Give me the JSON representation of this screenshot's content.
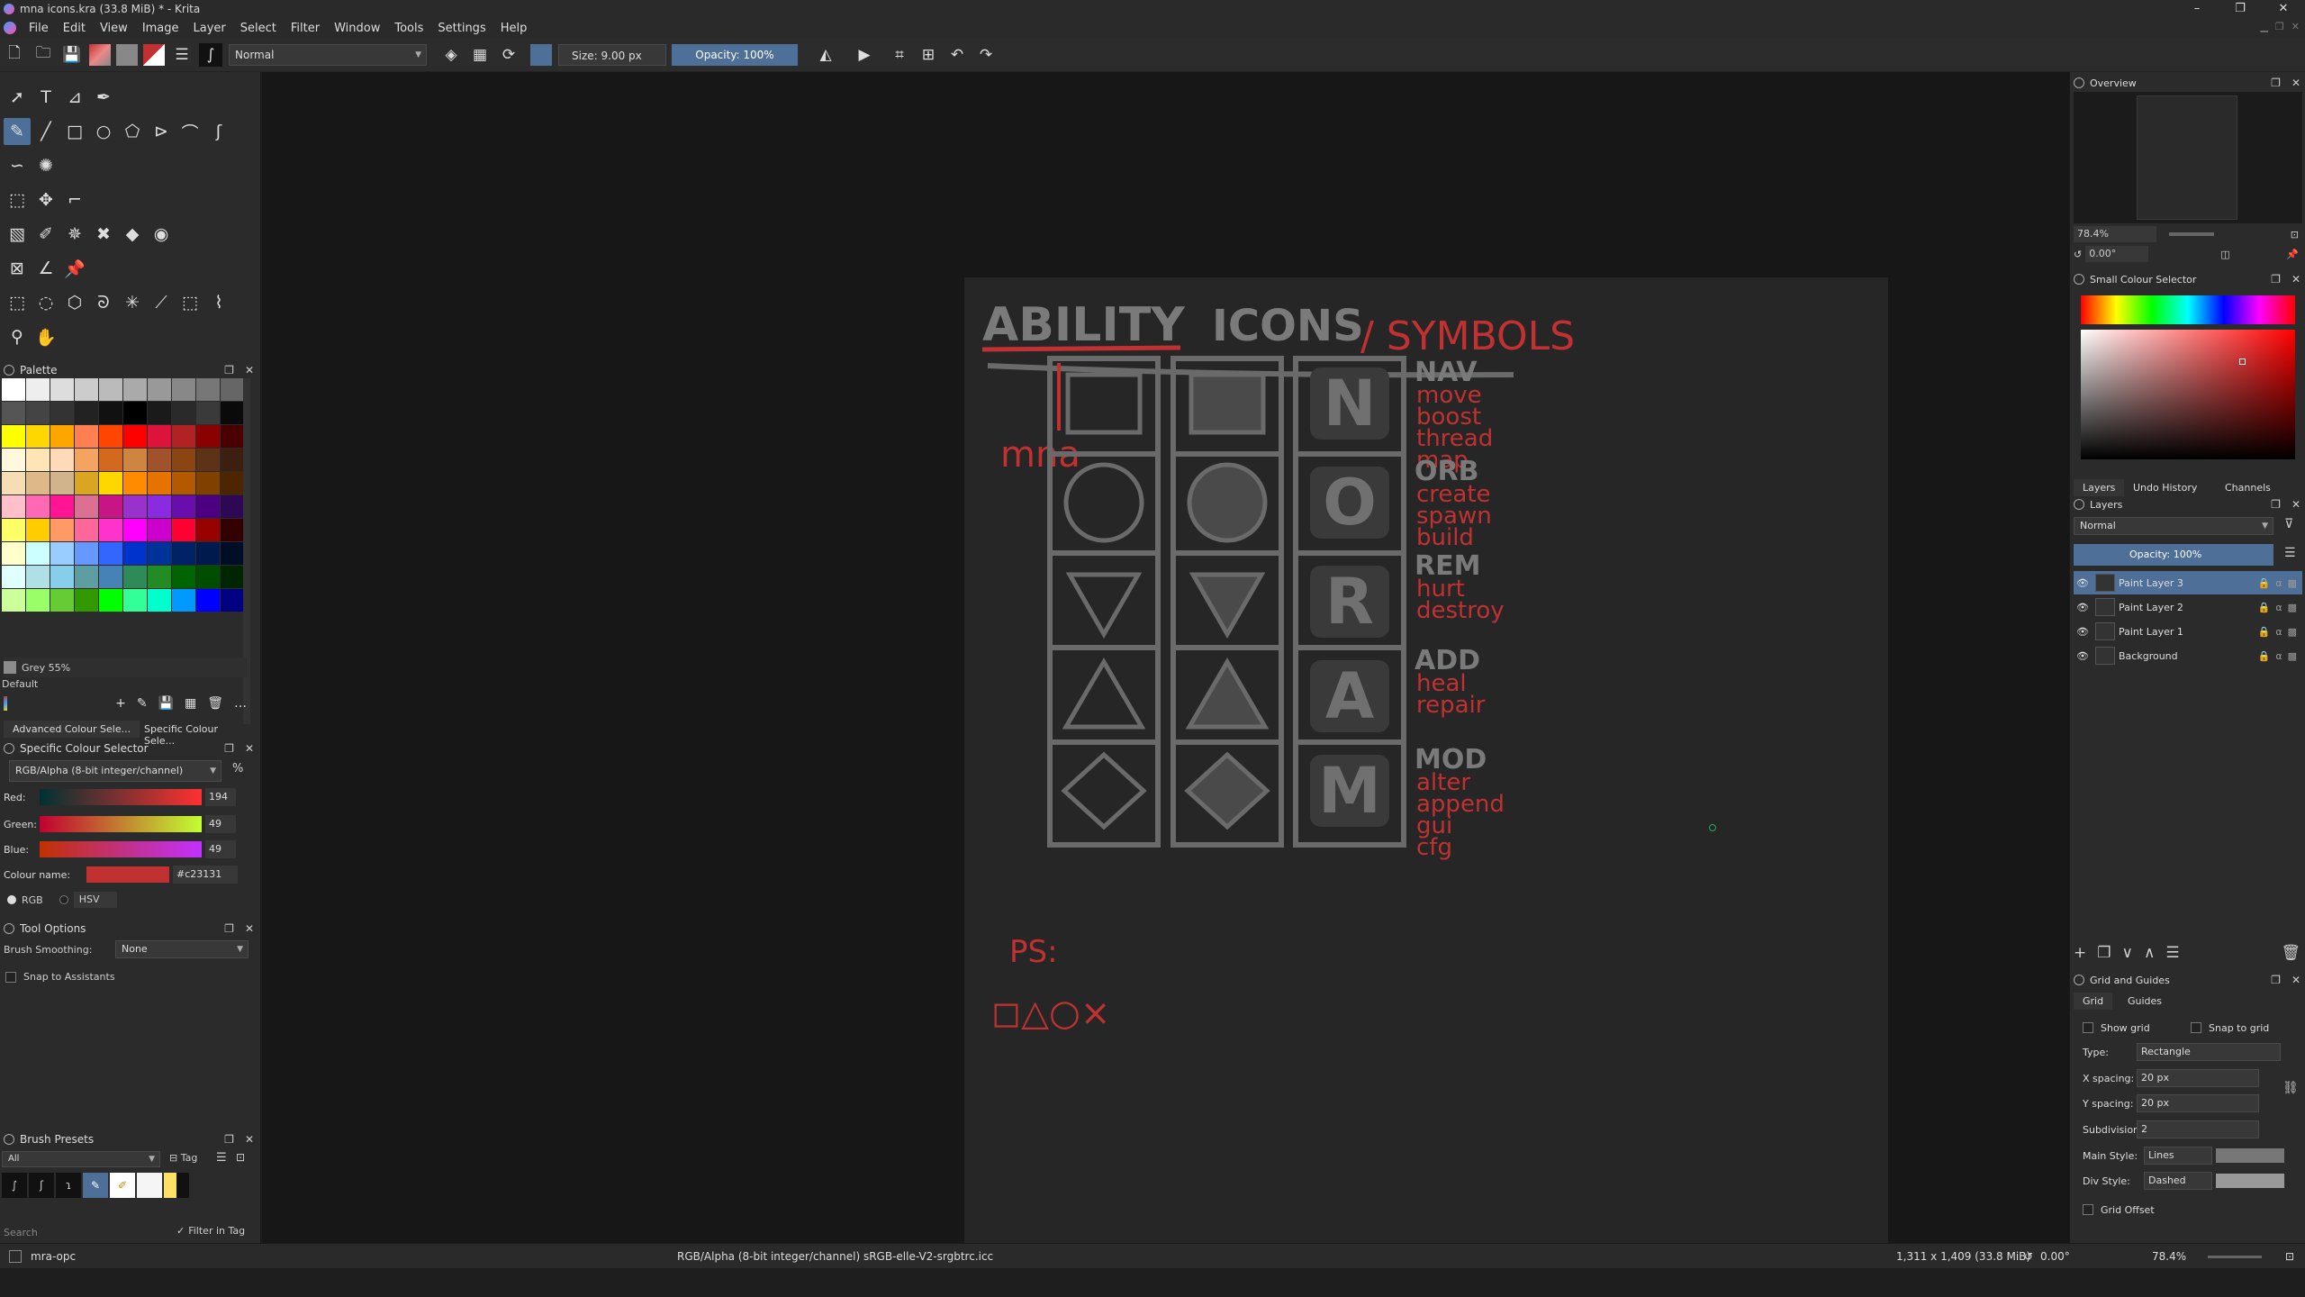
{
  "window": {
    "title": "mna icons.kra (33.8 MiB) * - Krita",
    "controls": [
      "–",
      "❐",
      "✕"
    ]
  },
  "menu": [
    "File",
    "Edit",
    "View",
    "Image",
    "Layer",
    "Select",
    "Filter",
    "Window",
    "Tools",
    "Settings",
    "Help"
  ],
  "toolbar": {
    "blend_mode": "Normal",
    "size": "Size: 9.00 px",
    "opacity": "Opacity: 100%"
  },
  "palette": {
    "title": "Palette",
    "current_color": "Grey 55%",
    "set_name": "Default",
    "colors": [
      "#ffffff",
      "#eeeeee",
      "#dddddd",
      "#cccccc",
      "#bbbbbb",
      "#aaaaaa",
      "#999999",
      "#888888",
      "#777777",
      "#666666",
      "#555555",
      "#444444",
      "#333333",
      "#222222",
      "#111111",
      "#000000",
      "#1a1a1a",
      "#2a2a2a",
      "#3a3a3a",
      "#0a0a0a",
      "#ffff00",
      "#ffd700",
      "#ffa500",
      "#ff7f50",
      "#ff4500",
      "#ff0000",
      "#dc143c",
      "#b22222",
      "#8b0000",
      "#4a0000",
      "#fff8dc",
      "#ffe4b5",
      "#ffdab9",
      "#f4a460",
      "#d2691e",
      "#cd853f",
      "#a0522d",
      "#8b4513",
      "#5c3317",
      "#3d1f0f",
      "#f5deb3",
      "#deb887",
      "#d2b48c",
      "#daa520",
      "#ffd700",
      "#ff8c00",
      "#e67300",
      "#b35900",
      "#804000",
      "#4d2600",
      "#ffc0cb",
      "#ff69b4",
      "#ff1493",
      "#db7093",
      "#c71585",
      "#9932cc",
      "#8a2be2",
      "#6a0dad",
      "#4b0082",
      "#2e0854",
      "#ffff66",
      "#ffcc00",
      "#ff9966",
      "#ff6699",
      "#ff33cc",
      "#ff00ff",
      "#cc00cc",
      "#ff0033",
      "#990000",
      "#330000",
      "#ffffcc",
      "#ccffff",
      "#99ccff",
      "#6699ff",
      "#3366ff",
      "#0033cc",
      "#003399",
      "#002266",
      "#001a4d",
      "#000d26",
      "#e0ffff",
      "#b0e0e6",
      "#87ceeb",
      "#5f9ea0",
      "#4682b4",
      "#2e8b57",
      "#228b22",
      "#006400",
      "#004d00",
      "#002600",
      "#ccff99",
      "#99ff66",
      "#66cc33",
      "#339900",
      "#00ff00",
      "#33ff99",
      "#00ffcc",
      "#0099ff",
      "#0000ff",
      "#000080"
    ]
  },
  "colour_tabs": [
    "Advanced Colour Sele...",
    "Specific Colour Sele..."
  ],
  "specific_colour": {
    "title": "Specific Colour Selector",
    "model": "RGB/Alpha (8-bit integer/channel)",
    "percent": "%",
    "red_label": "Red:",
    "red": "194",
    "green_label": "Green:",
    "green": "49",
    "blue_label": "Blue:",
    "blue": "49",
    "name_label": "Colour name:",
    "name": "#c23131",
    "rgb": "RGB",
    "hsv": "HSV",
    "swatch": "#c23131"
  },
  "tool_options": {
    "title": "Tool Options",
    "smoothing_label": "Brush Smoothing:",
    "smoothing": "None",
    "snap": "Snap to Assistants"
  },
  "brush_presets": {
    "title": "Brush Presets",
    "filter": "All",
    "tag": "Tag",
    "search": "Search",
    "filter_in_tag": "Filter in Tag"
  },
  "overview": {
    "title": "Overview",
    "zoom": "78.4%",
    "rotation": "0.00°"
  },
  "small_colour": {
    "title": "Small Colour Selector"
  },
  "right_tabs": [
    "Layers",
    "Undo History",
    "Channels"
  ],
  "layers": {
    "title": "Layers",
    "blend": "Normal",
    "opacity": "Opacity: 100%",
    "items": [
      {
        "name": "Paint Layer 3",
        "active": true
      },
      {
        "name": "Paint Layer 2",
        "active": false
      },
      {
        "name": "Paint Layer 1",
        "active": false
      },
      {
        "name": "Background",
        "active": false
      }
    ]
  },
  "grid": {
    "title": "Grid and Guides",
    "tabs": [
      "Grid",
      "Guides"
    ],
    "show_grid": "Show grid",
    "snap_grid": "Snap to grid",
    "type_label": "Type:",
    "type": "Rectangle",
    "x_label": "X spacing:",
    "x": "20 px",
    "y_label": "Y spacing:",
    "y": "20 px",
    "sub_label": "Subdivision:",
    "sub": "2",
    "main_label": "Main Style:",
    "main": "Lines",
    "div_label": "Div Style:",
    "div": "Dashed",
    "offset": "Grid Offset"
  },
  "status": {
    "brush": "mra-opc",
    "profile": "RGB/Alpha (8-bit integer/channel)  sRGB-elle-V2-srgbtrc.icc",
    "size": "1,311 x 1,409 (33.8 MiB)",
    "rotation": "0.00°",
    "zoom": "78.4%"
  },
  "artwork": {
    "heading_1": "ABILITY",
    "heading_2": "ICONS",
    "heading_3": "/ SYMBOLS",
    "mna": "mna",
    "ps": "PS:",
    "ps_glyphs": "◻△○×",
    "row_letters": [
      "N",
      "O",
      "R",
      "A",
      "M"
    ],
    "labels": [
      {
        "head": "NAV",
        "items": [
          "move",
          "boost",
          "thread",
          "map"
        ]
      },
      {
        "head": "ORB",
        "items": [
          "create",
          "spawn",
          "build"
        ]
      },
      {
        "head": "REM",
        "items": [
          "hurt",
          "destroy"
        ]
      },
      {
        "head": "ADD",
        "items": [
          "heal",
          "repair"
        ]
      },
      {
        "head": "MOD",
        "items": [
          "alter",
          "append",
          "gui",
          "cfg"
        ]
      }
    ],
    "ink_red": "#c23131",
    "ink_grey": "#6a6a6a"
  }
}
